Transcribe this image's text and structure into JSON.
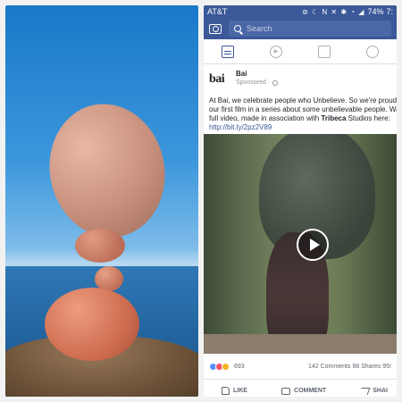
{
  "status_bar": {
    "carrier": "AT&T",
    "icons": "⊘ ☾ N ✕ ✱ ◔ ◢",
    "battery": "74%",
    "time": "7:"
  },
  "fb_header": {
    "search_placeholder": "Search"
  },
  "post": {
    "author": "Bai",
    "logo_text": "bai",
    "meta_label": "Sponsored ·",
    "text_lines": [
      "At Bai, we celebrate people who Unbelieve. So we're proud to s",
      "our first film in a series about some unbelievable people. Watch",
      "full video, made in association with ",
      "Studios here:"
    ],
    "bold_text": "Tribeca",
    "link": "http://bit.ly/2pz2V89"
  },
  "engagement": {
    "reaction_count": "693",
    "comments": "142 Comments",
    "shares": "98 Shares",
    "views": "95!"
  },
  "actions": {
    "like": "LIKE",
    "comment": "COMMENT",
    "share": "SHAI"
  }
}
